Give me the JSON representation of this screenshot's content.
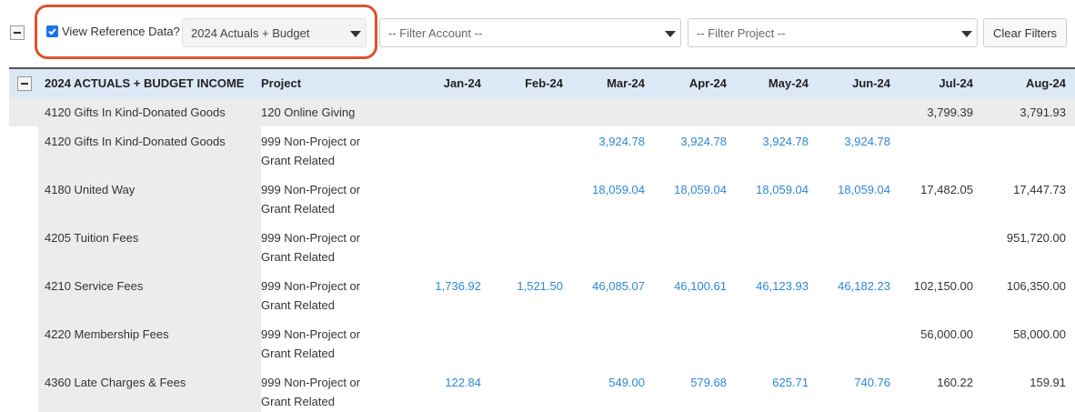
{
  "toolbar": {
    "reference_checkbox_label": "View Reference Data?",
    "reference_checked": true,
    "reference_select_value": "2024 Actuals + Budget",
    "account_filter_placeholder": "-- Filter Account --",
    "project_filter_placeholder": "-- Filter Project --",
    "clear_filters_label": "Clear Filters"
  },
  "table": {
    "columns": [
      "2024 ACTUALS + BUDGET INCOME",
      "Project",
      "Jan-24",
      "Feb-24",
      "Mar-24",
      "Apr-24",
      "May-24",
      "Jun-24",
      "Jul-24",
      "Aug-24"
    ],
    "rows": [
      {
        "account": "4120 Gifts In Kind-Donated Goods",
        "project": [
          "120 Online Giving"
        ],
        "values": [
          "",
          "",
          "",
          "",
          "",
          "",
          "3,799.39",
          "3,791.93"
        ],
        "highlighted": true
      },
      {
        "account": "4120 Gifts In Kind-Donated Goods",
        "project": [
          "999 Non-Project or",
          "Grant Related"
        ],
        "values": [
          "",
          "",
          "3,924.78",
          "3,924.78",
          "3,924.78",
          "3,924.78",
          "",
          ""
        ],
        "highlighted": false
      },
      {
        "account": "4180 United Way",
        "project": [
          "999 Non-Project or",
          "Grant Related"
        ],
        "values": [
          "",
          "",
          "18,059.04",
          "18,059.04",
          "18,059.04",
          "18,059.04",
          "17,482.05",
          "17,447.73"
        ],
        "highlighted": false
      },
      {
        "account": "4205 Tuition Fees",
        "project": [
          "999 Non-Project or",
          "Grant Related"
        ],
        "values": [
          "",
          "",
          "",
          "",
          "",
          "",
          "",
          "951,720.00"
        ],
        "highlighted": false
      },
      {
        "account": "4210 Service Fees",
        "project": [
          "999 Non-Project or",
          "Grant Related"
        ],
        "values": [
          "1,736.92",
          "1,521.50",
          "46,085.07",
          "46,100.61",
          "46,123.93",
          "46,182.23",
          "102,150.00",
          "106,350.00"
        ],
        "highlighted": false
      },
      {
        "account": "4220 Membership Fees",
        "project": [
          "999 Non-Project or",
          "Grant Related"
        ],
        "values": [
          "",
          "",
          "",
          "",
          "",
          "",
          "56,000.00",
          "58,000.00"
        ],
        "highlighted": false
      },
      {
        "account": "4360 Late Charges & Fees",
        "project": [
          "999 Non-Project or",
          "Grant Related"
        ],
        "values": [
          "122.84",
          "",
          "549.00",
          "579.68",
          "625.71",
          "740.76",
          "160.22",
          "159.91"
        ],
        "highlighted": false
      }
    ]
  },
  "colors": {
    "highlight_border": "#d9542b",
    "header_bg": "#dde8f7",
    "link_value": "#2f86d8",
    "checkbox": "#1a73e8"
  }
}
